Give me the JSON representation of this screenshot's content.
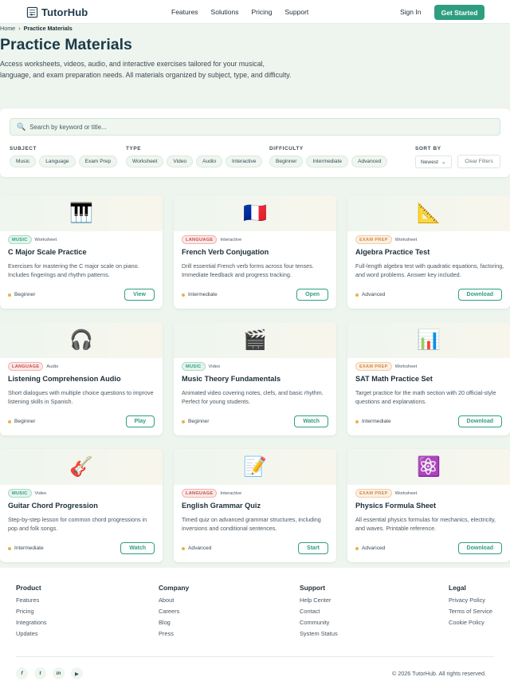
{
  "header": {
    "brand": "TutorHub",
    "nav": [
      "Features",
      "Solutions",
      "Pricing",
      "Support"
    ],
    "signin": "Sign In",
    "cta": "Get Started"
  },
  "breadcrumb": {
    "home": "Home",
    "separator": "›",
    "current": "Practice Materials"
  },
  "hero": {
    "title": "Practice Materials",
    "description": "Access worksheets, videos, audio, and interactive exercises tailored for your musical, language, and exam preparation needs. All materials organized by subject, type, and difficulty."
  },
  "filters": {
    "search_placeholder": "Search by keyword or title...",
    "subject": {
      "label": "SUBJECT",
      "options": [
        "Music",
        "Language",
        "Exam Prep"
      ]
    },
    "type": {
      "label": "TYPE",
      "options": [
        "Worksheet",
        "Video",
        "Audio",
        "Interactive"
      ]
    },
    "difficulty": {
      "label": "DIFFICULTY",
      "options": [
        "Beginner",
        "Intermediate",
        "Advanced"
      ]
    },
    "sort": {
      "label": "SORT BY",
      "value": "Newest"
    },
    "clear": "Clear Filters"
  },
  "cards": [
    {
      "emoji": "🎹",
      "subject": "MUSIC",
      "subject_kind": "music",
      "type": "Worksheet",
      "title": "C Major Scale Practice",
      "description": "Exercises for mastering the C major scale on piano. Includes fingerings and rhythm patterns.",
      "level": "Beginner",
      "action": "View"
    },
    {
      "emoji": "🇫🇷",
      "subject": "LANGUAGE",
      "subject_kind": "language",
      "type": "Interactive",
      "title": "French Verb Conjugation",
      "description": "Drill essential French verb forms across four tenses. Immediate feedback and progress tracking.",
      "level": "Intermediate",
      "action": "Open"
    },
    {
      "emoji": "📐",
      "subject": "EXAM PREP",
      "subject_kind": "exam",
      "type": "Worksheet",
      "title": "Algebra Practice Test",
      "description": "Full-length algebra test with quadratic equations, factoring, and word problems. Answer key included.",
      "level": "Advanced",
      "action": "Download"
    },
    {
      "emoji": "🎧",
      "subject": "LANGUAGE",
      "subject_kind": "language",
      "type": "Audio",
      "title": "Listening Comprehension Audio",
      "description": "Short dialogues with multiple choice questions to improve listening skills in Spanish.",
      "level": "Beginner",
      "action": "Play"
    },
    {
      "emoji": "🎬",
      "subject": "MUSIC",
      "subject_kind": "music",
      "type": "Video",
      "title": "Music Theory Fundamentals",
      "description": "Animated video covering notes, clefs, and basic rhythm. Perfect for young students.",
      "level": "Beginner",
      "action": "Watch"
    },
    {
      "emoji": "📊",
      "subject": "EXAM PREP",
      "subject_kind": "exam",
      "type": "Worksheet",
      "title": "SAT Math Practice Set",
      "description": "Target practice for the math section with 20 official-style questions and explanations.",
      "level": "Intermediate",
      "action": "Download"
    },
    {
      "emoji": "🎸",
      "subject": "MUSIC",
      "subject_kind": "music",
      "type": "Video",
      "title": "Guitar Chord Progression",
      "description": "Step-by-step lesson for common chord progressions in pop and folk songs.",
      "level": "Intermediate",
      "action": "Watch"
    },
    {
      "emoji": "📝",
      "subject": "LANGUAGE",
      "subject_kind": "language",
      "type": "Interactive",
      "title": "English Grammar Quiz",
      "description": "Timed quiz on advanced grammar structures, including inversions and conditional sentences.",
      "level": "Advanced",
      "action": "Start"
    },
    {
      "emoji": "⚛️",
      "subject": "EXAM PREP",
      "subject_kind": "exam",
      "type": "Worksheet",
      "title": "Physics Formula Sheet",
      "description": "All essential physics formulas for mechanics, electricity, and waves. Printable reference.",
      "level": "Advanced",
      "action": "Download"
    }
  ],
  "footer": {
    "columns": [
      {
        "title": "Product",
        "links": [
          "Features",
          "Pricing",
          "Integrations",
          "Updates"
        ]
      },
      {
        "title": "Company",
        "links": [
          "About",
          "Careers",
          "Blog",
          "Press"
        ]
      },
      {
        "title": "Support",
        "links": [
          "Help Center",
          "Contact",
          "Community",
          "System Status"
        ]
      },
      {
        "title": "Legal",
        "links": [
          "Privacy Policy",
          "Terms of Service",
          "Cookie Policy"
        ]
      }
    ],
    "socials": [
      "f",
      "t",
      "in",
      "▶"
    ],
    "copyright": "© 2026 TutorHub. All rights reserved."
  },
  "colors": {
    "accent": "#2f9e80",
    "background": "#edf5ee",
    "title": "#1d3b4a"
  }
}
